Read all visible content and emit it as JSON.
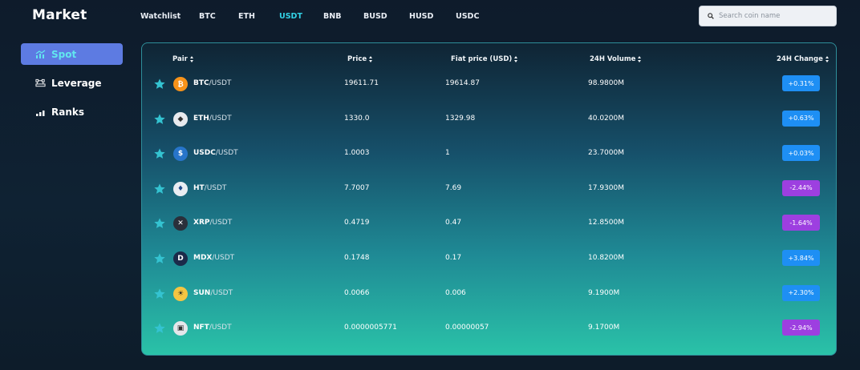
{
  "brand": "Market",
  "search": {
    "placeholder": "Search coin name"
  },
  "nav": {
    "tabs": [
      {
        "label": "Watchlist",
        "active": false
      },
      {
        "label": "BTC",
        "active": false
      },
      {
        "label": "ETH",
        "active": false
      },
      {
        "label": "USDT",
        "active": true
      },
      {
        "label": "BNB",
        "active": false
      },
      {
        "label": "BUSD",
        "active": false
      },
      {
        "label": "HUSD",
        "active": false
      },
      {
        "label": "USDC",
        "active": false
      }
    ]
  },
  "sidebar": {
    "items": [
      {
        "label": "Spot",
        "icon": "chart-icon",
        "active": true
      },
      {
        "label": "Leverage",
        "icon": "leverage-icon",
        "active": false
      },
      {
        "label": "Ranks",
        "icon": "bars-icon",
        "active": false
      }
    ]
  },
  "table": {
    "headers": {
      "pair": "Pair",
      "price": "Price",
      "fiat": "Fiat price (USD)",
      "volume": "24H Volume",
      "change": "24H Change"
    },
    "rows": [
      {
        "base": "BTC",
        "quote": "/USDT",
        "price": "19611.71",
        "fiat": "19614.87",
        "volume": "98.9800M",
        "change": "+0.31%",
        "dir": "up",
        "icon": "btc-icon"
      },
      {
        "base": "ETH",
        "quote": "/USDT",
        "price": "1330.0",
        "fiat": "1329.98",
        "volume": "40.0200M",
        "change": "+0.63%",
        "dir": "up",
        "icon": "eth-icon"
      },
      {
        "base": "USDC",
        "quote": "/USDT",
        "price": "1.0003",
        "fiat": "1",
        "volume": "23.7000M",
        "change": "+0.03%",
        "dir": "up",
        "icon": "usdc-icon"
      },
      {
        "base": "HT",
        "quote": "/USDT",
        "price": "7.7007",
        "fiat": "7.69",
        "volume": "17.9300M",
        "change": "-2.44%",
        "dir": "down",
        "icon": "ht-icon"
      },
      {
        "base": "XRP",
        "quote": "/USDT",
        "price": "0.4719",
        "fiat": "0.47",
        "volume": "12.8500M",
        "change": "-1.64%",
        "dir": "down",
        "icon": "xrp-icon"
      },
      {
        "base": "MDX",
        "quote": "/USDT",
        "price": "0.1748",
        "fiat": "0.17",
        "volume": "10.8200M",
        "change": "+3.84%",
        "dir": "up",
        "icon": "mdx-icon"
      },
      {
        "base": "SUN",
        "quote": "/USDT",
        "price": "0.0066",
        "fiat": "0.006",
        "volume": "9.1900M",
        "change": "+2.30%",
        "dir": "up",
        "icon": "sun-icon"
      },
      {
        "base": "NFT",
        "quote": "/USDT",
        "price": "0.0000005771",
        "fiat": "0.00000057",
        "volume": "9.1700M",
        "change": "-2.94%",
        "dir": "down",
        "icon": "nft-icon"
      }
    ]
  },
  "colors": {
    "accent": "#33d2e6",
    "active_side_bg": "#5d7be2",
    "up": "#1e8ff4",
    "down": "#9d3fe0"
  }
}
